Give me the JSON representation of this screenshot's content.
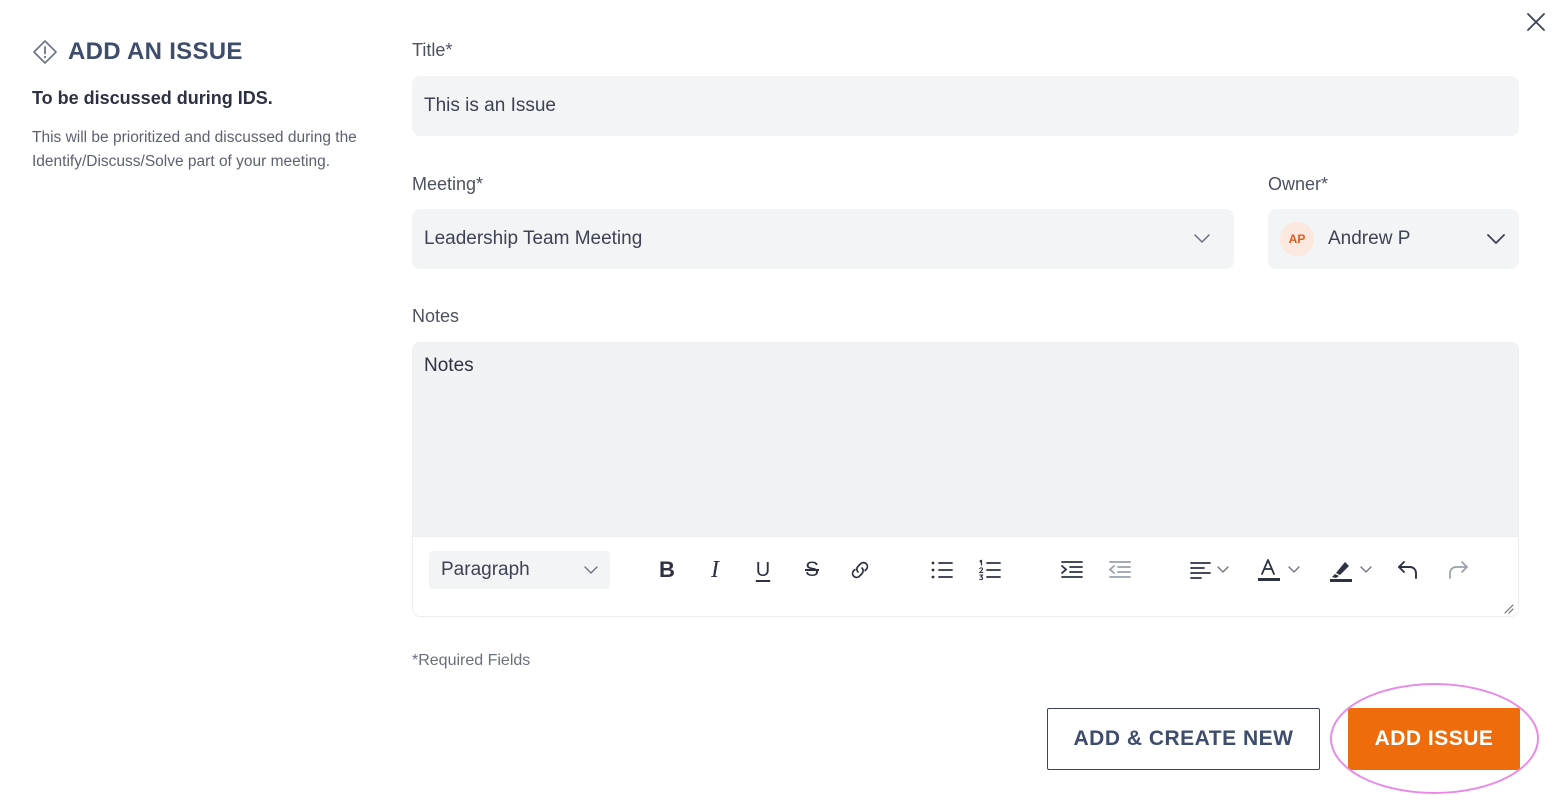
{
  "side": {
    "title": "ADD AN ISSUE",
    "subtitle": "To be discussed during IDS.",
    "description": "This will be prioritized and discussed during the Identify/Discuss/Solve part of your meeting."
  },
  "form": {
    "title_label": "Title*",
    "title_value": "This is an Issue",
    "meeting_label": "Meeting*",
    "meeting_value": "Leadership Team Meeting",
    "owner_label": "Owner*",
    "owner_initials": "AP",
    "owner_value": "Andrew P",
    "notes_label": "Notes",
    "notes_value": "Notes",
    "paragraph_value": "Paragraph",
    "required_note": "*Required Fields"
  },
  "toolbar": {
    "bold": "B",
    "italic": "I",
    "underline": "U",
    "strike": "S"
  },
  "buttons": {
    "add_create_new": "ADD & CREATE NEW",
    "add_issue": "ADD ISSUE"
  },
  "colors": {
    "primary": "#ef6c0d",
    "heading": "#3e4d6c",
    "field_bg": "#f3f4f5",
    "highlight": "#e88ae6"
  }
}
